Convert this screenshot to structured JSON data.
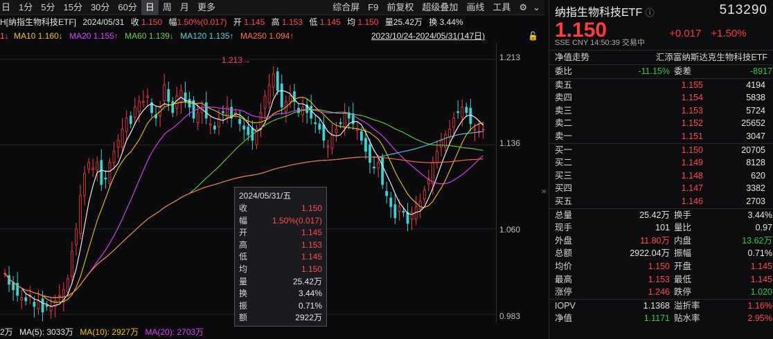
{
  "toolbar": {
    "periods": [
      "日",
      "1分",
      "5分",
      "15分",
      "30分",
      "60分",
      "日",
      "周",
      "月",
      "更多"
    ],
    "active_index": 6,
    "tools": [
      "综合屏",
      "F9",
      "前复权",
      "超级叠加",
      "画线",
      "工具"
    ]
  },
  "quote_line": {
    "name": "H[纳指生物科技ETF]",
    "date": "2024/05/31",
    "close_label": "收",
    "close": "1.150",
    "chg_label": "幅",
    "chg": "1.50%(0.017)",
    "open_label": "开",
    "open": "1.145",
    "high_label": "高",
    "high": "1.153",
    "low_label": "低",
    "low": "1.145",
    "avg_label": "均",
    "avg": "1.150",
    "vol_label": "量",
    "vol": "25.42万",
    "turn_label": "换",
    "turn": "3.44%"
  },
  "ma_line": {
    "lead": "1↓",
    "ma10": "MA10 1.160↓",
    "ma20": "MA20 1.155↑",
    "ma60": "MA60 1.139↓",
    "ma120": "MA120 1.135↑",
    "ma250": "MA250 1.094↑",
    "range": "2023/10/24-2024/05/31(147日)"
  },
  "chart_data": {
    "type": "candlestick",
    "ylim": [
      0.975,
      1.228
    ],
    "yticks": [
      "1.213",
      "1.136",
      "1.060",
      "0.983"
    ],
    "high_marker": "1.213→",
    "closes": [
      1.02,
      1.01,
      1.005,
      1.0,
      0.998,
      0.995,
      1.0,
      0.99,
      0.995,
      0.985,
      0.99,
      0.99,
      0.995,
      1.0,
      1.005,
      1.015,
      1.04,
      1.06,
      1.09,
      1.11,
      1.12,
      1.115,
      1.12,
      1.1,
      1.105,
      1.12,
      1.13,
      1.14,
      1.15,
      1.16,
      1.155,
      1.17,
      1.175,
      1.175,
      1.18,
      1.165,
      1.16,
      1.17,
      1.19,
      1.175,
      1.165,
      1.18,
      1.185,
      1.175,
      1.17,
      1.16,
      1.165,
      1.17,
      1.16,
      1.155,
      1.15,
      1.16,
      1.165,
      1.17,
      1.16,
      1.165,
      1.155,
      1.15,
      1.145,
      1.14,
      1.15,
      1.165,
      1.18,
      1.19,
      1.2,
      1.185,
      1.17,
      1.175,
      1.18,
      1.175,
      1.165,
      1.17,
      1.165,
      1.16,
      1.155,
      1.15,
      1.14,
      1.135,
      1.145,
      1.15,
      1.155,
      1.165,
      1.16,
      1.155,
      1.15,
      1.14,
      1.13,
      1.12,
      1.115,
      1.12,
      1.1,
      1.09,
      1.08,
      1.07,
      1.08,
      1.075,
      1.065,
      1.075,
      1.08,
      1.085,
      1.095,
      1.105,
      1.12,
      1.13,
      1.14,
      1.145,
      1.15,
      1.16,
      1.165,
      1.17,
      1.165,
      1.155,
      1.15,
      1.148,
      1.15
    ]
  },
  "tooltip": {
    "date": "2024/05/31/五",
    "rows": [
      {
        "k": "收",
        "v": "1.150",
        "c": "red"
      },
      {
        "k": "幅",
        "v": "1.50%(0.017)",
        "c": "red"
      },
      {
        "k": "开",
        "v": "1.145",
        "c": "red"
      },
      {
        "k": "高",
        "v": "1.153",
        "c": "red"
      },
      {
        "k": "低",
        "v": "1.145",
        "c": "red"
      },
      {
        "k": "均",
        "v": "1.150",
        "c": "red"
      },
      {
        "k": "量",
        "v": "25.42万",
        "c": "white"
      },
      {
        "k": "换",
        "v": "3.44%",
        "c": "white"
      },
      {
        "k": "振",
        "v": "0.71%",
        "c": "white"
      },
      {
        "k": "额",
        "v": "2922万",
        "c": "white"
      }
    ]
  },
  "bottom_bar": {
    "lead": "2万",
    "ma5": "MA(5): 3033万",
    "ma10": "MA(10): 2927万",
    "ma20": "MA(20): 2703万"
  },
  "panel": {
    "name": "纳指生物科技ETF",
    "code": "513290",
    "price": "1.150",
    "change": "+0.017",
    "pct": "+1.50%",
    "meta": "SSE  CNY  14:50:39  交易中",
    "nav_trend_label": "净值走势",
    "nav_trend_name": "汇添富纳斯达克生物科技ETF",
    "ratio_label": "委比",
    "ratio": "-11.15%",
    "diff_label": "委差",
    "diff": "-8917",
    "asks": [
      {
        "label": "卖五",
        "price": "1.155",
        "vol": "4194"
      },
      {
        "label": "卖四",
        "price": "1.154",
        "vol": "5838"
      },
      {
        "label": "卖三",
        "price": "1.153",
        "vol": "5724"
      },
      {
        "label": "卖二",
        "price": "1.152",
        "vol": "25652"
      },
      {
        "label": "卖一",
        "price": "1.151",
        "vol": "3047"
      }
    ],
    "bids": [
      {
        "label": "买一",
        "price": "1.150",
        "vol": "20705"
      },
      {
        "label": "买二",
        "price": "1.149",
        "vol": "8128"
      },
      {
        "label": "买三",
        "price": "1.148",
        "vol": "620"
      },
      {
        "label": "买四",
        "price": "1.147",
        "vol": "3382"
      },
      {
        "label": "买五",
        "price": "1.146",
        "vol": "2703"
      }
    ],
    "stats": [
      {
        "l1": "总量",
        "v1": "25.42万",
        "c1": "white",
        "l2": "换手",
        "v2": "3.44%",
        "c2": "white"
      },
      {
        "l1": "现手",
        "v1": "101",
        "c1": "white",
        "l2": "量比",
        "v2": "0.97",
        "c2": "white"
      },
      {
        "l1": "外盘",
        "v1": "11.80万",
        "c1": "red",
        "l2": "内盘",
        "v2": "13.62万",
        "c2": "green"
      },
      {
        "l1": "总额",
        "v1": "2922.04万",
        "c1": "white",
        "l2": "振幅",
        "v2": "0.71%",
        "c2": "white"
      },
      {
        "l1": "均价",
        "v1": "1.150",
        "c1": "red",
        "l2": "开盘",
        "v2": "1.145",
        "c2": "red"
      },
      {
        "l1": "最高",
        "v1": "1.153",
        "c1": "red",
        "l2": "最低",
        "v2": "1.145",
        "c2": "red"
      },
      {
        "l1": "涨停",
        "v1": "1.246",
        "c1": "red",
        "l2": "跌停",
        "v2": "1.020",
        "c2": "green"
      }
    ],
    "iopv": [
      {
        "l1": "IOPV",
        "v1": "1.1368",
        "c1": "white",
        "l2": "溢折率",
        "v2": "1.16%",
        "c2": "red"
      },
      {
        "l1": "净值",
        "v1": "1.1171",
        "c1": "green",
        "l2": "贴水率",
        "v2": "2.95%",
        "c2": "red"
      }
    ]
  }
}
